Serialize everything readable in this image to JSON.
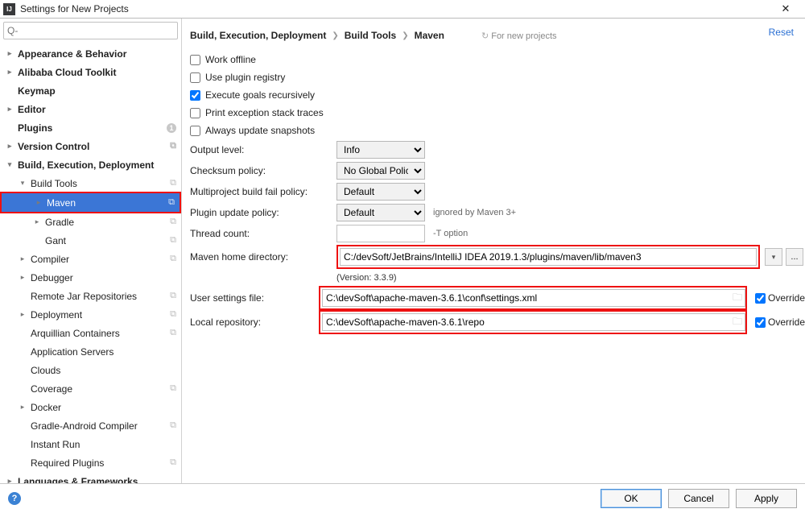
{
  "window": {
    "title": "Settings for New Projects"
  },
  "search": {
    "placeholder": "Q-"
  },
  "sidebar": {
    "items": [
      {
        "label": "Appearance & Behavior",
        "tw": "▸",
        "bold": true,
        "lvl": 0
      },
      {
        "label": "Alibaba Cloud Toolkit",
        "tw": "▸",
        "bold": true,
        "lvl": 0
      },
      {
        "label": "Keymap",
        "tw": "",
        "bold": true,
        "lvl": 0
      },
      {
        "label": "Editor",
        "tw": "▸",
        "bold": true,
        "lvl": 0
      },
      {
        "label": "Plugins",
        "tw": "",
        "bold": true,
        "lvl": 0,
        "badge": "1"
      },
      {
        "label": "Version Control",
        "tw": "▸",
        "bold": true,
        "lvl": 0,
        "stack": true
      },
      {
        "label": "Build, Execution, Deployment",
        "tw": "▾",
        "bold": true,
        "lvl": 0
      },
      {
        "label": "Build Tools",
        "tw": "▾",
        "bold": false,
        "lvl": 1,
        "stack": true
      },
      {
        "label": "Maven",
        "tw": "▸",
        "bold": false,
        "lvl": 2,
        "stack": true,
        "selected": true,
        "hl": true
      },
      {
        "label": "Gradle",
        "tw": "▸",
        "bold": false,
        "lvl": 2,
        "stack": true
      },
      {
        "label": "Gant",
        "tw": "",
        "bold": false,
        "lvl": 2,
        "stack": true
      },
      {
        "label": "Compiler",
        "tw": "▸",
        "bold": false,
        "lvl": 1,
        "stack": true
      },
      {
        "label": "Debugger",
        "tw": "▸",
        "bold": false,
        "lvl": 1
      },
      {
        "label": "Remote Jar Repositories",
        "tw": "",
        "bold": false,
        "lvl": 1,
        "stack": true
      },
      {
        "label": "Deployment",
        "tw": "▸",
        "bold": false,
        "lvl": 1,
        "stack": true
      },
      {
        "label": "Arquillian Containers",
        "tw": "",
        "bold": false,
        "lvl": 1,
        "stack": true
      },
      {
        "label": "Application Servers",
        "tw": "",
        "bold": false,
        "lvl": 1
      },
      {
        "label": "Clouds",
        "tw": "",
        "bold": false,
        "lvl": 1
      },
      {
        "label": "Coverage",
        "tw": "",
        "bold": false,
        "lvl": 1,
        "stack": true
      },
      {
        "label": "Docker",
        "tw": "▸",
        "bold": false,
        "lvl": 1
      },
      {
        "label": "Gradle-Android Compiler",
        "tw": "",
        "bold": false,
        "lvl": 1,
        "stack": true
      },
      {
        "label": "Instant Run",
        "tw": "",
        "bold": false,
        "lvl": 1
      },
      {
        "label": "Required Plugins",
        "tw": "",
        "bold": false,
        "lvl": 1,
        "stack": true
      },
      {
        "label": "Languages & Frameworks",
        "tw": "▸",
        "bold": true,
        "lvl": 0
      }
    ]
  },
  "breadcrumb": {
    "a": "Build, Execution, Deployment",
    "b": "Build Tools",
    "c": "Maven",
    "note": "For new projects",
    "reset": "Reset"
  },
  "checks": {
    "work_offline": "Work offline",
    "use_plugin_registry": "Use plugin registry",
    "execute_goals": "Execute goals recursively",
    "print_exception": "Print exception stack traces",
    "always_update": "Always update snapshots"
  },
  "form": {
    "output_level_lbl": "Output level:",
    "output_level_val": "Info",
    "checksum_lbl": "Checksum policy:",
    "checksum_val": "No Global Policy",
    "multiproject_lbl": "Multiproject build fail policy:",
    "multiproject_val": "Default",
    "plugin_update_lbl": "Plugin update policy:",
    "plugin_update_val": "Default",
    "plugin_update_note": "ignored by Maven 3+",
    "thread_lbl": "Thread count:",
    "thread_val": "",
    "thread_note": "-T option",
    "home_lbl": "Maven home directory:",
    "home_val": "C:/devSoft/JetBrains/IntelliJ IDEA 2019.1.3/plugins/maven/lib/maven3",
    "home_version": "(Version: 3.3.9)",
    "settings_lbl": "User settings file:",
    "settings_val": "C:\\devSoft\\apache-maven-3.6.1\\conf\\settings.xml",
    "repo_lbl": "Local repository:",
    "repo_val": "C:\\devSoft\\apache-maven-3.6.1\\repo",
    "override": "Override"
  },
  "footer": {
    "ok": "OK",
    "cancel": "Cancel",
    "apply": "Apply"
  }
}
